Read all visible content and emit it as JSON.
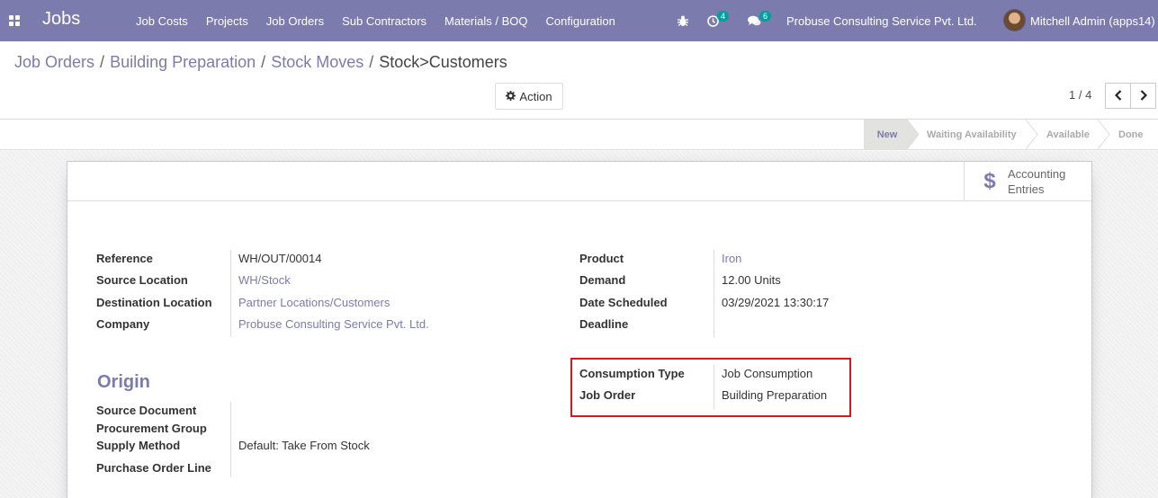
{
  "navbar": {
    "brand": "Jobs",
    "menu": [
      "Job Costs",
      "Projects",
      "Job Orders",
      "Sub Contractors",
      "Materials / BOQ",
      "Configuration"
    ],
    "activity_count": "4",
    "message_count": "6",
    "company": "Probuse Consulting Service Pvt. Ltd.",
    "user": "Mitchell Admin (apps14)"
  },
  "breadcrumb": {
    "items": [
      "Job Orders",
      "Building Preparation",
      "Stock Moves"
    ],
    "current": "Stock>Customers",
    "separator": "/"
  },
  "toolbar": {
    "action_label": "Action",
    "pager": "1 / 4"
  },
  "statusbar": {
    "stages": [
      "New",
      "Waiting Availability",
      "Available",
      "Done"
    ],
    "active": "New"
  },
  "smart_button": {
    "line1": "Accounting",
    "line2": "Entries"
  },
  "form": {
    "left": [
      {
        "label": "Reference",
        "value": "WH/OUT/00014"
      },
      {
        "label": "Source Location",
        "value": "WH/Stock"
      },
      {
        "label": "Destination Location",
        "value": "Partner Locations/Customers"
      },
      {
        "label": "Company",
        "value": "Probuse Consulting Service Pvt. Ltd."
      }
    ],
    "right": [
      {
        "label": "Product",
        "value": "Iron"
      },
      {
        "label": "Demand",
        "value": "12.00 Units"
      },
      {
        "label": "Date Scheduled",
        "value": "03/29/2021 13:30:17"
      },
      {
        "label": "Deadline",
        "value": ""
      }
    ],
    "consumption": [
      {
        "label": "Consumption Type",
        "value": "Job Consumption"
      },
      {
        "label": "Job Order",
        "value": "Building Preparation"
      }
    ],
    "origin_title": "Origin",
    "origin": [
      {
        "label": "Source Document",
        "value": ""
      },
      {
        "label": "Procurement Group",
        "value": ""
      },
      {
        "label": "Supply Method",
        "value": "Default: Take From Stock"
      },
      {
        "label": "Purchase Order Line",
        "value": ""
      }
    ]
  },
  "colors": {
    "brand": "#7c7bad",
    "badge": "#00a09d",
    "highlight": "#d7191c"
  }
}
